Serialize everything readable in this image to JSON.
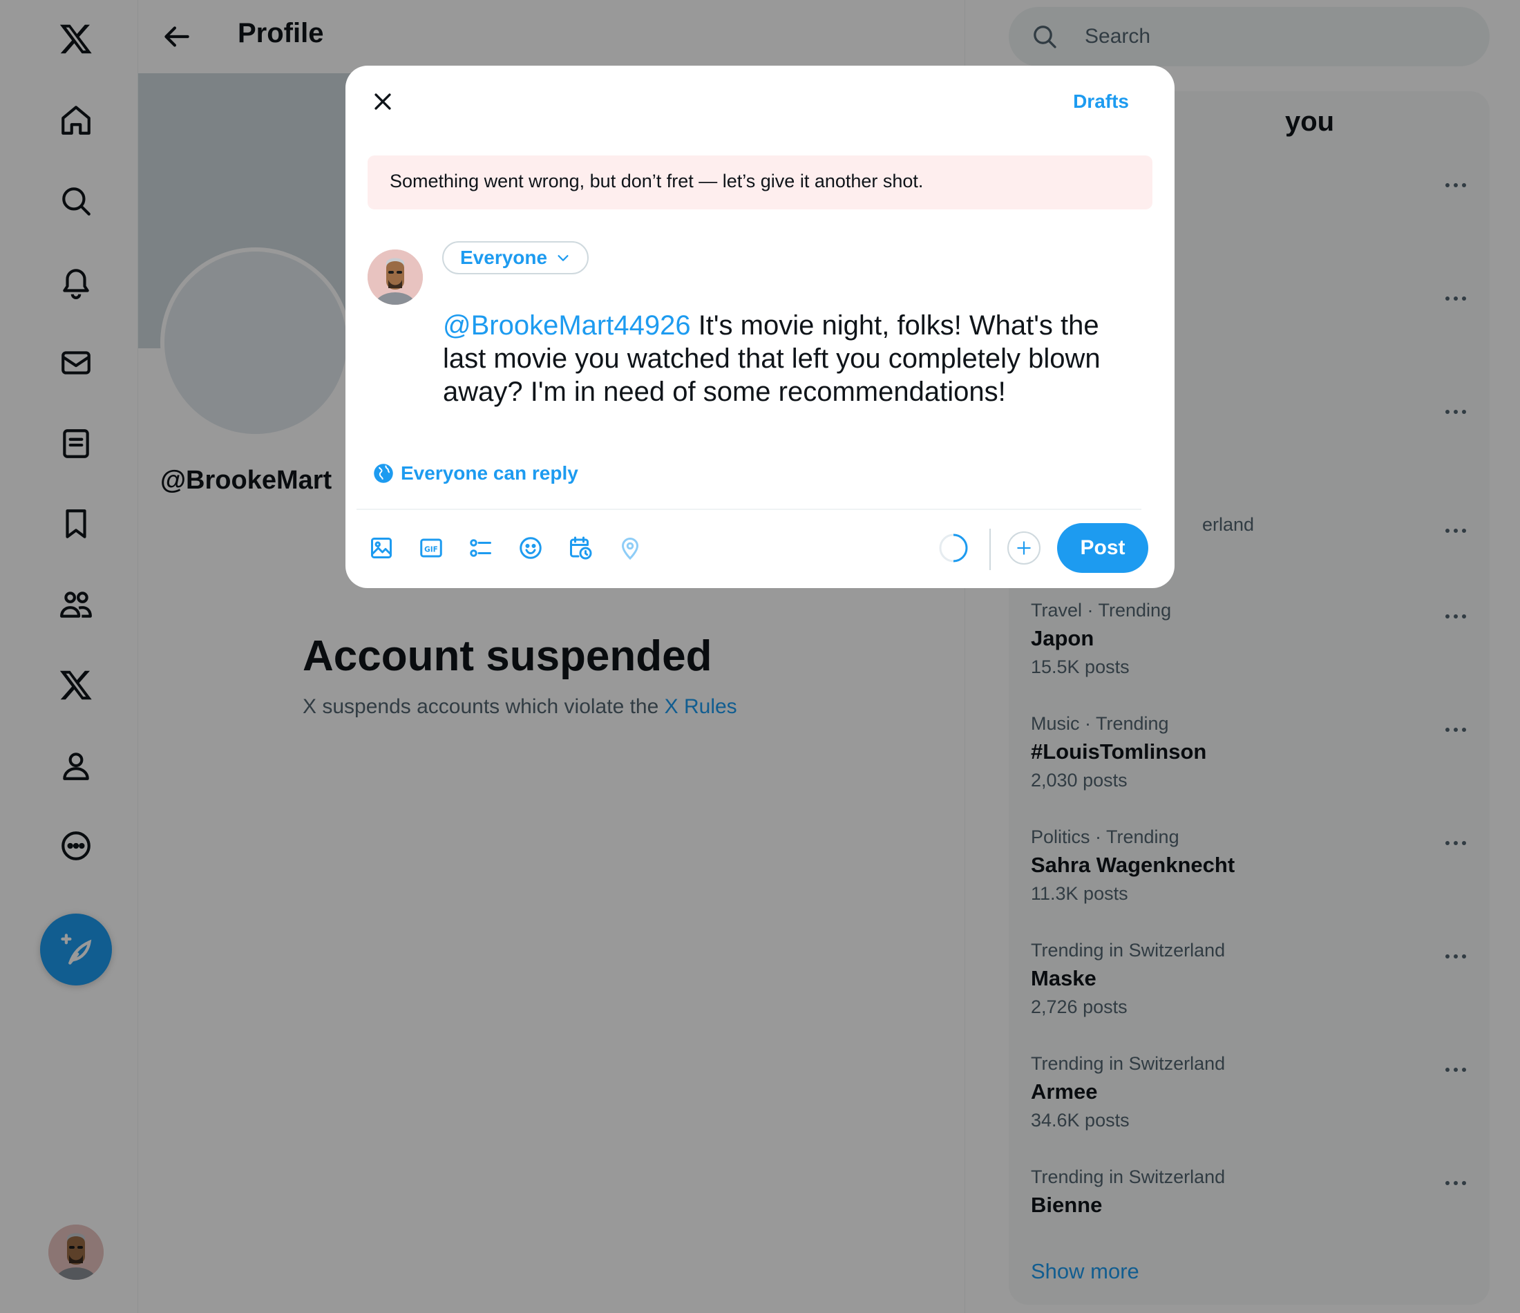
{
  "nav": {
    "items": [
      {
        "name": "x-logo-icon",
        "label": ""
      },
      {
        "name": "home-icon",
        "label": ""
      },
      {
        "name": "explore-icon",
        "label": ""
      },
      {
        "name": "notifications-icon",
        "label": ""
      },
      {
        "name": "messages-icon",
        "label": ""
      },
      {
        "name": "lists-icon",
        "label": ""
      },
      {
        "name": "bookmarks-icon",
        "label": ""
      },
      {
        "name": "communities-icon",
        "label": ""
      },
      {
        "name": "premium-x-icon",
        "label": ""
      },
      {
        "name": "profile-icon",
        "label": ""
      },
      {
        "name": "more-icon",
        "label": ""
      }
    ],
    "compose_icon": "feather-plus-icon"
  },
  "main": {
    "title": "Profile",
    "handle": "@BrookeMart",
    "suspended_title": "Account suspended",
    "suspended_text": "X suspends accounts which violate the ",
    "rules_link": "X Rules"
  },
  "search": {
    "placeholder": "Search"
  },
  "trends": {
    "title_visible": "you",
    "partial_items": [
      {
        "visible_fragment": "erland"
      }
    ],
    "items": [
      {
        "context": "Travel · Trending",
        "name": "Japon",
        "count": "15.5K posts"
      },
      {
        "context": "Music · Trending",
        "name": "#LouisTomlinson",
        "count": "2,030 posts"
      },
      {
        "context": "Politics · Trending",
        "name": "Sahra Wagenknecht",
        "count": "11.3K posts"
      },
      {
        "context": "Trending in Switzerland",
        "name": "Maske",
        "count": "2,726 posts"
      },
      {
        "context": "Trending in Switzerland",
        "name": "Armee",
        "count": "34.6K posts"
      },
      {
        "context": "Trending in Switzerland",
        "name": "Bienne",
        "count": ""
      }
    ],
    "show_more": "Show more"
  },
  "compose": {
    "drafts_label": "Drafts",
    "error_message": "Something went wrong, but don’t fret — let’s give it another shot.",
    "audience_label": "Everyone",
    "mention": "@BrookeMart44926",
    "body": " It's movie night, folks! What's the last movie you watched that left you completely blown away? I'm in need of some recommendations!",
    "reply_setting": "Everyone can reply",
    "post_label": "Post",
    "toolbar_icons": [
      "image-icon",
      "gif-icon",
      "poll-icon",
      "emoji-icon",
      "schedule-icon",
      "location-icon"
    ]
  },
  "colors": {
    "accent": "#1d9bf0",
    "error_bg": "#feeeee",
    "muted_text": "#536471",
    "overlay": "rgba(0,0,0,0.4)"
  }
}
